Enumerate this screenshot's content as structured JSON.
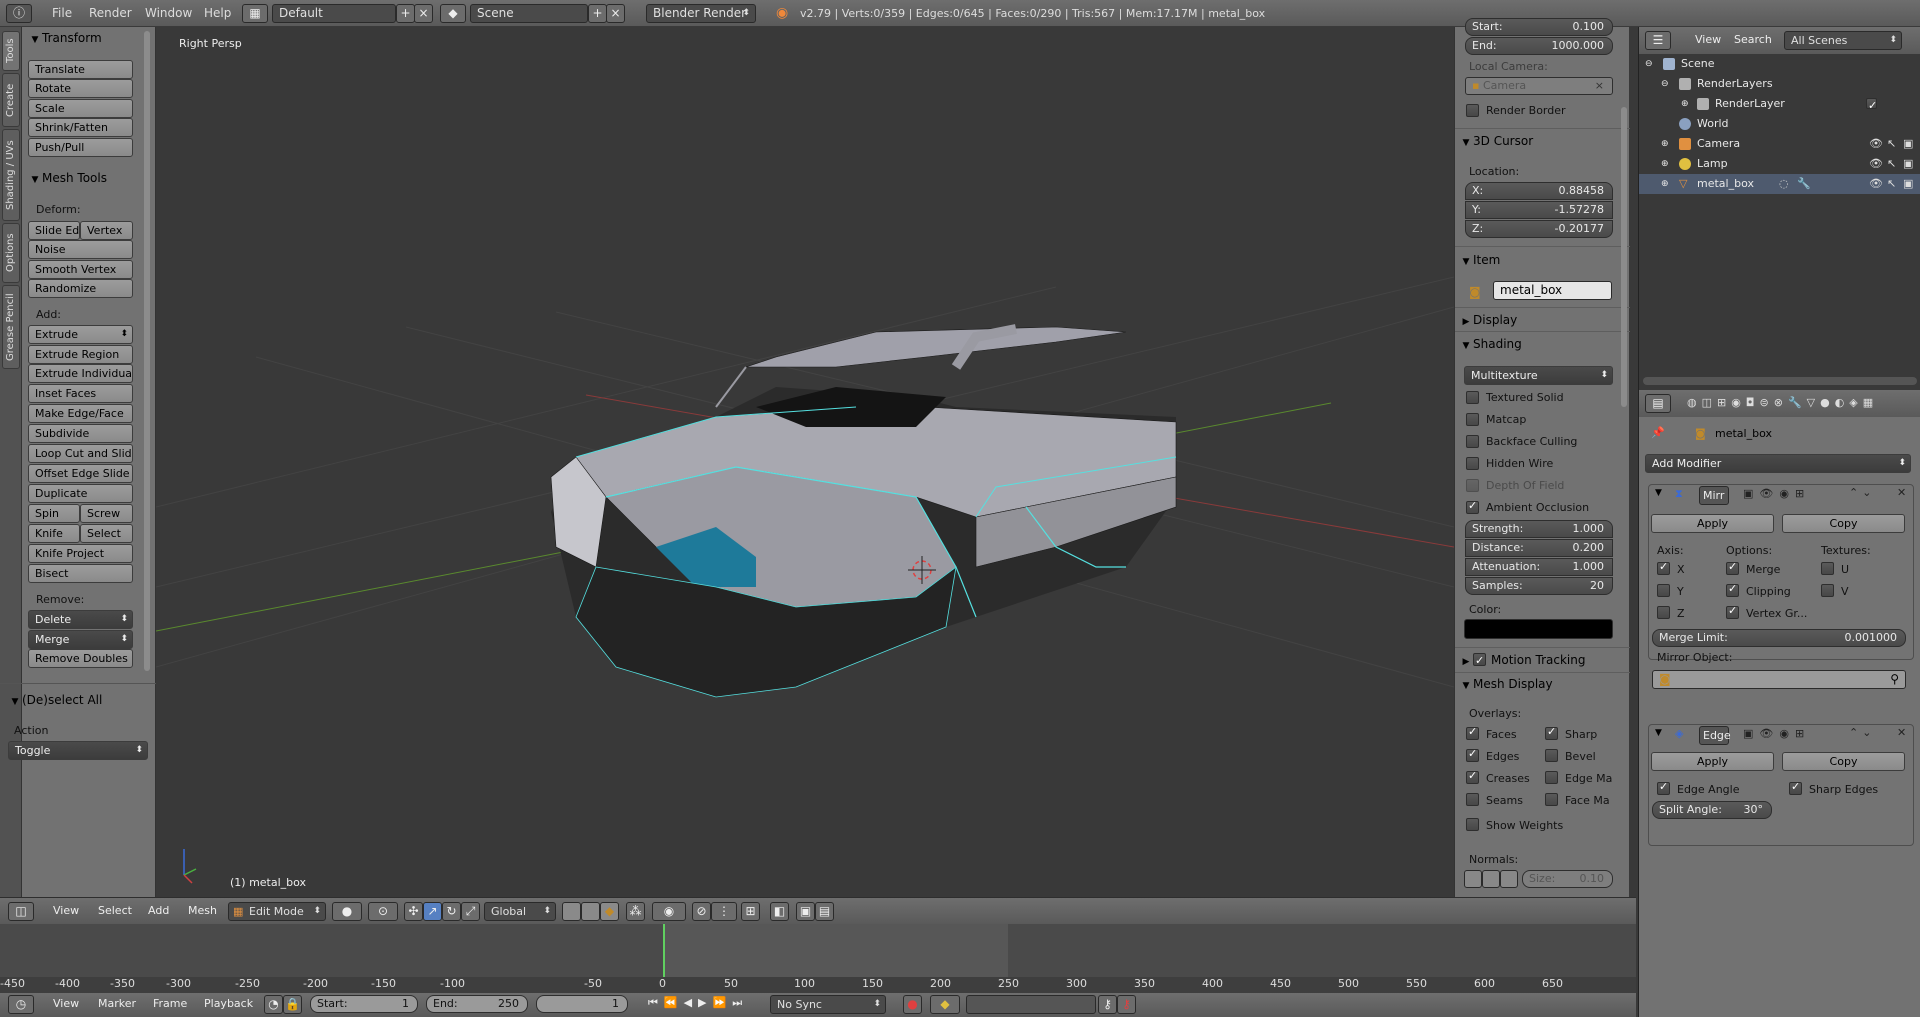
{
  "topbar": {
    "menus": [
      "File",
      "Render",
      "Window",
      "Help"
    ],
    "layout": "Default",
    "scene": "Scene",
    "engine": "Blender Render",
    "stats": "v2.79 | Verts:0/359 | Edges:0/645 | Faces:0/290 | Tris:567 | Mem:17.17M | metal_box"
  },
  "tabs": [
    "Tools",
    "Create",
    "Shading / UVs",
    "Options",
    "Grease Pencil"
  ],
  "toolshelf": {
    "transform_title": "Transform",
    "transform": [
      "Translate",
      "Rotate",
      "Scale",
      "Shrink/Fatten",
      "Push/Pull"
    ],
    "mesh_tools_title": "Mesh Tools",
    "deform_label": "Deform:",
    "slide_edge": "Slide Ed",
    "vertex": "Vertex",
    "noise": "Noise",
    "smooth_vertex": "Smooth Vertex",
    "randomize": "Randomize",
    "add_label": "Add:",
    "extrude": "Extrude",
    "add": [
      "Extrude Region",
      "Extrude Individual",
      "Inset Faces",
      "Make Edge/Face",
      "Subdivide",
      "Loop Cut and Slide",
      "Offset Edge Slide",
      "Duplicate"
    ],
    "spin": "Spin",
    "screw": "Screw",
    "knife": "Knife",
    "select": "Select",
    "knife_project": "Knife Project",
    "bisect": "Bisect",
    "remove_label": "Remove:",
    "delete": "Delete",
    "merge": "Merge",
    "remove_doubles": "Remove Doubles",
    "deselect_title": "(De)select All",
    "action_label": "Action",
    "action_value": "Toggle"
  },
  "viewport": {
    "view_name": "Right Persp",
    "object_label": "(1) metal_box"
  },
  "props": {
    "start_label": "Start:",
    "start_value": "0.100",
    "end_label": "End:",
    "end_value": "1000.000",
    "local_camera": "Local Camera:",
    "camera_placeholder": "Camera",
    "render_border": "Render Border",
    "cursor_title": "3D Cursor",
    "location_label": "Location:",
    "x_label": "X:",
    "x_value": "0.88458",
    "y_label": "Y:",
    "y_value": "-1.57278",
    "z_label": "Z:",
    "z_value": "-0.20177",
    "item_title": "Item",
    "item_name": "metal_box",
    "display_title": "Display",
    "shading_title": "Shading",
    "shading_mode": "Multitexture",
    "textured_solid": "Textured Solid",
    "matcap": "Matcap",
    "backface": "Backface Culling",
    "hidden_wire": "Hidden Wire",
    "depth_of_field": "Depth Of Field",
    "ambient_occlusion": "Ambient Occlusion",
    "strength_label": "Strength:",
    "strength_value": "1.000",
    "distance_label": "Distance:",
    "distance_value": "0.200",
    "attenuation_label": "Attenuation:",
    "attenuation_value": "1.000",
    "samples_label": "Samples:",
    "samples_value": "20",
    "color_label": "Color:",
    "ao_color": "#000000",
    "motion_tracking": "Motion Tracking",
    "mesh_display_title": "Mesh Display",
    "overlays_label": "Overlays:",
    "faces": "Faces",
    "sharp": "Sharp",
    "edges": "Edges",
    "bevel": "Bevel",
    "creases": "Creases",
    "edge_marks": "Edge Ma",
    "seams": "Seams",
    "face_marks": "Face Ma",
    "show_weights": "Show Weights",
    "normals_label": "Normals:",
    "size_label": "Size:",
    "size_value": "0.10"
  },
  "outliner": {
    "view": "View",
    "search": "Search",
    "filter": "All Scenes",
    "rows": [
      "Scene",
      "RenderLayers",
      "RenderLayer",
      "World",
      "Camera",
      "Lamp",
      "metal_box"
    ]
  },
  "modifiers": {
    "object_name": "metal_box",
    "add_modifier": "Add Modifier",
    "mirror_name": "Mirr",
    "apply": "Apply",
    "copy": "Copy",
    "axis_label": "Axis:",
    "options_label": "Options:",
    "textures_label": "Textures:",
    "x": "X",
    "y": "Y",
    "z": "Z",
    "merge": "Merge",
    "clipping": "Clipping",
    "vertex_groups": "Vertex Gr...",
    "u": "U",
    "v": "V",
    "merge_limit_label": "Merge Limit:",
    "merge_limit_value": "0.001000",
    "mirror_object_label": "Mirror Object:",
    "edge_name": "Edge",
    "edge_angle": "Edge Angle",
    "sharp_edges": "Sharp Edges",
    "split_angle_label": "Split Angle:",
    "split_angle_value": "30°"
  },
  "view_header": {
    "menus": [
      "View",
      "Select",
      "Add",
      "Mesh"
    ],
    "mode": "Edit Mode",
    "orientation": "Global"
  },
  "timeline": {
    "ticks": [
      "-450",
      "-400",
      "-350",
      "-300",
      "-250",
      "-200",
      "-150",
      "-100",
      "-50",
      "0",
      "50",
      "100",
      "150",
      "200",
      "250",
      "300",
      "350",
      "400",
      "450",
      "500",
      "550",
      "600",
      "650"
    ],
    "menus": [
      "View",
      "Marker",
      "Frame",
      "Playback"
    ],
    "start_label": "Start:",
    "start_value": "1",
    "end_label": "End:",
    "end_value": "250",
    "current_frame": "1",
    "sync": "No Sync"
  }
}
